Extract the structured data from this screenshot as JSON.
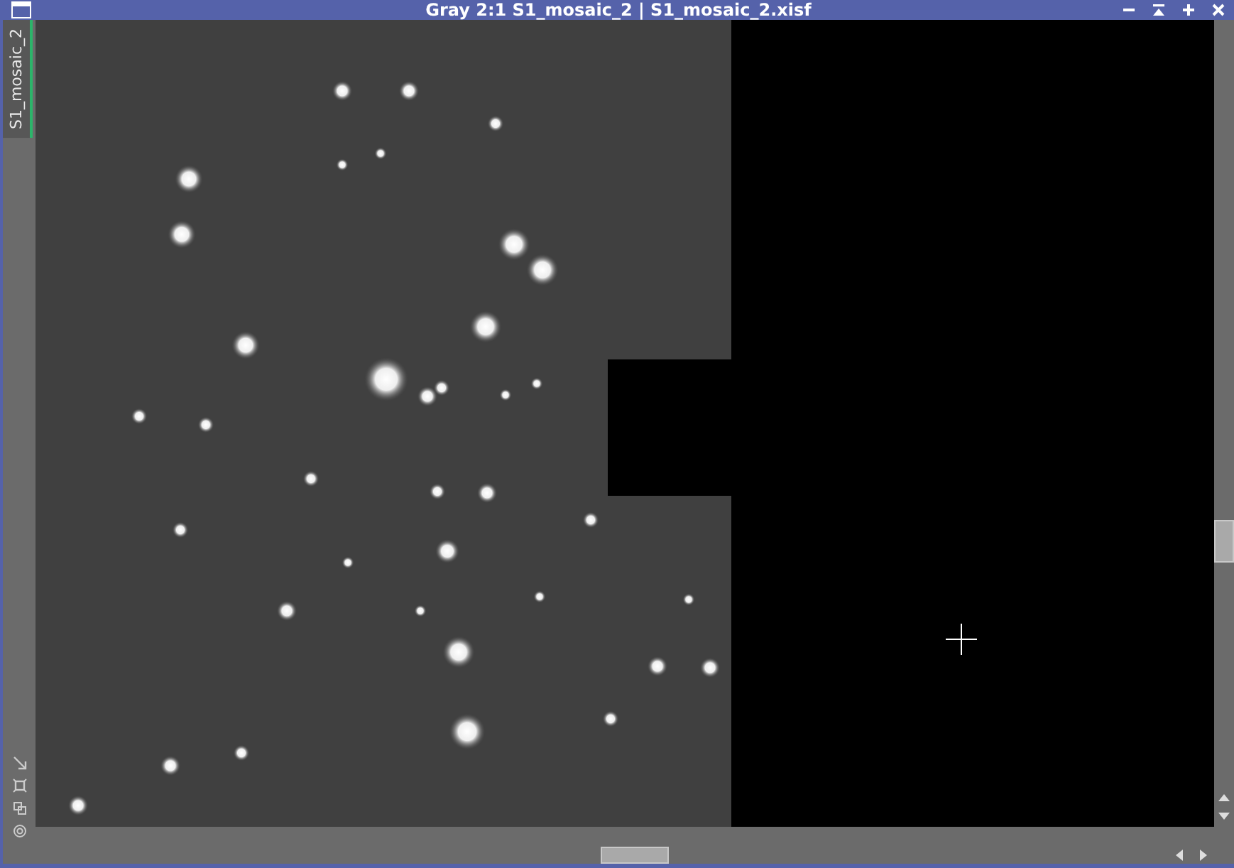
{
  "window": {
    "title": "Gray 2:1 S1_mosaic_2 | S1_mosaic_2.xisf"
  },
  "tabs": [
    {
      "label": "S1_mosaic_2",
      "selected": true
    }
  ]
}
